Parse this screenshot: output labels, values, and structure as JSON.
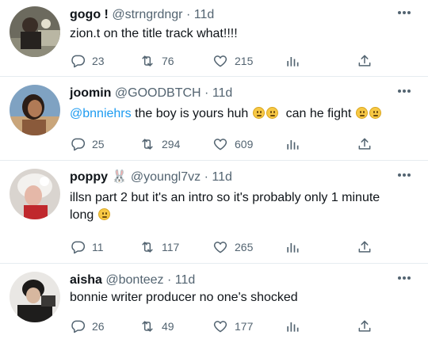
{
  "tweets": [
    {
      "name": "gogo !",
      "handle": "@strngrdngr",
      "separator": "·",
      "time": "11d",
      "text_parts": [
        {
          "type": "text",
          "value": "zion.t on the title track what!!!!"
        }
      ],
      "replies": "23",
      "retweets": "76",
      "likes": "215"
    },
    {
      "name": "joomin",
      "handle": "@GOODBTCH",
      "separator": "·",
      "time": "11d",
      "mention": "@bnniehrs",
      "text_a": "the boy is yours huh",
      "text_b": "can he fight",
      "replies": "25",
      "retweets": "294",
      "likes": "609"
    },
    {
      "name": "poppy",
      "name_emoji": "🐰",
      "handle": "@youngl7vz",
      "separator": "·",
      "time": "11d",
      "text_line1": "illsn part 2 but it's an intro so it's probably only 1 minute",
      "text_line2": "long",
      "replies": "11",
      "retweets": "117",
      "likes": "265"
    },
    {
      "name": "aisha",
      "handle": "@bonteez",
      "separator": "·",
      "time": "11d",
      "text": "bonnie writer producer no one's shocked",
      "replies": "26",
      "retweets": "49",
      "likes": "177"
    }
  ],
  "icons": {
    "reply": "reply-icon",
    "retweet": "retweet-icon",
    "like": "heart-icon",
    "stats": "analytics-icon",
    "share": "share-icon",
    "more": "more-icon"
  },
  "colors": {
    "mention": "#1d9bf0",
    "secondary": "#536471",
    "divider": "#e6ecf0"
  }
}
